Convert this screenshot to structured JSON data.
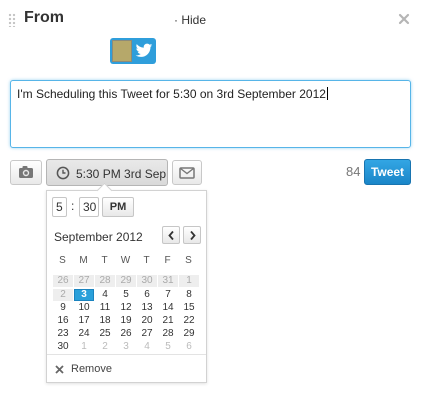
{
  "header": {
    "title": "From",
    "hide_label": "· Hide"
  },
  "account": {
    "service": "Twitter"
  },
  "compose": {
    "text": "I'm Scheduling this Tweet for 5:30 on 3rd September 2012"
  },
  "toolbar": {
    "schedule_label": "5:30 PM 3rd Sep",
    "char_count": "84",
    "tweet_label": "Tweet"
  },
  "scheduler": {
    "hour": "5",
    "separator": ":",
    "minute": "30",
    "ampm": "PM",
    "month_label": "September 2012",
    "weekdays": [
      "S",
      "M",
      "T",
      "W",
      "T",
      "F",
      "S"
    ],
    "weeks": [
      [
        {
          "d": "26",
          "s": "disabled"
        },
        {
          "d": "27",
          "s": "disabled"
        },
        {
          "d": "28",
          "s": "disabled"
        },
        {
          "d": "29",
          "s": "disabled"
        },
        {
          "d": "30",
          "s": "disabled"
        },
        {
          "d": "31",
          "s": "disabled"
        },
        {
          "d": "1",
          "s": "disabled"
        }
      ],
      [
        {
          "d": "2",
          "s": "disabled"
        },
        {
          "d": "3",
          "s": "selected"
        },
        {
          "d": "4",
          "s": ""
        },
        {
          "d": "5",
          "s": ""
        },
        {
          "d": "6",
          "s": ""
        },
        {
          "d": "7",
          "s": ""
        },
        {
          "d": "8",
          "s": ""
        }
      ],
      [
        {
          "d": "9",
          "s": ""
        },
        {
          "d": "10",
          "s": ""
        },
        {
          "d": "11",
          "s": ""
        },
        {
          "d": "12",
          "s": ""
        },
        {
          "d": "13",
          "s": ""
        },
        {
          "d": "14",
          "s": ""
        },
        {
          "d": "15",
          "s": ""
        }
      ],
      [
        {
          "d": "16",
          "s": ""
        },
        {
          "d": "17",
          "s": ""
        },
        {
          "d": "18",
          "s": ""
        },
        {
          "d": "19",
          "s": ""
        },
        {
          "d": "20",
          "s": ""
        },
        {
          "d": "21",
          "s": ""
        },
        {
          "d": "22",
          "s": ""
        }
      ],
      [
        {
          "d": "23",
          "s": ""
        },
        {
          "d": "24",
          "s": ""
        },
        {
          "d": "25",
          "s": ""
        },
        {
          "d": "26",
          "s": ""
        },
        {
          "d": "27",
          "s": ""
        },
        {
          "d": "28",
          "s": ""
        },
        {
          "d": "29",
          "s": ""
        }
      ],
      [
        {
          "d": "30",
          "s": ""
        },
        {
          "d": "1",
          "s": "other"
        },
        {
          "d": "2",
          "s": "other"
        },
        {
          "d": "3",
          "s": "other"
        },
        {
          "d": "4",
          "s": "other"
        },
        {
          "d": "5",
          "s": "other"
        },
        {
          "d": "6",
          "s": "other"
        }
      ]
    ],
    "remove_label": "Remove"
  },
  "colors": {
    "accent": "#2aa0da",
    "tweet_button": "#1a86c8",
    "focus_border": "#57b5e8"
  },
  "icons": [
    "drag-handle-icon",
    "close-icon",
    "twitter-bird-icon",
    "camera-icon",
    "clock-icon",
    "mail-icon",
    "chevron-left-icon",
    "chevron-right-icon",
    "remove-x-icon"
  ]
}
